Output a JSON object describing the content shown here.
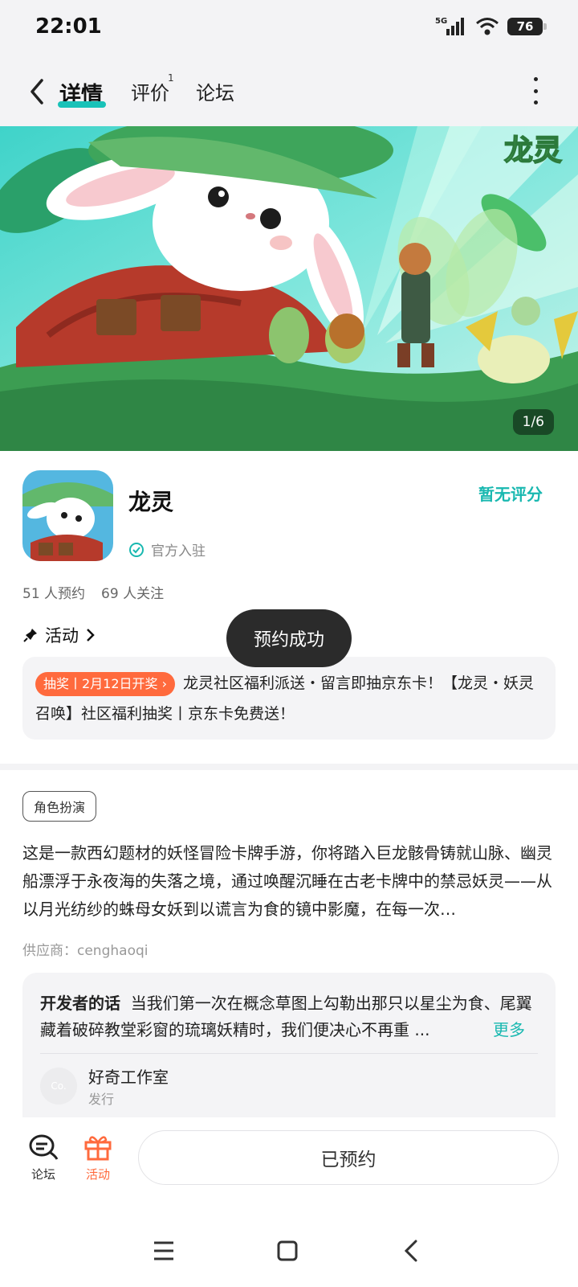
{
  "status_bar": {
    "time": "22:01",
    "network": "5G",
    "battery": "76"
  },
  "header": {
    "tabs": [
      {
        "label": "详情",
        "active": true
      },
      {
        "label": "评价",
        "badge": "1"
      },
      {
        "label": "论坛"
      }
    ]
  },
  "banner": {
    "counter": "1/6",
    "watermark": "龙灵"
  },
  "app": {
    "name": "龙灵",
    "official_label": "官方入驻",
    "rating": "暂无评分",
    "reservations": "51 人预约",
    "followers": "69 人关注"
  },
  "activity": {
    "heading": "活动",
    "badge": "抽奖丨2月12日开奖",
    "text": "龙灵社区福利派送・留言即抽京东卡！【龙灵・妖灵召唤】社区福利抽奖丨京东卡免费送！"
  },
  "toast": "预约成功",
  "description": {
    "tag": "角色扮演",
    "text": "这是一款西幻题材的妖怪冒险卡牌手游，你将踏入巨龙骸骨铸就山脉、幽灵船漂浮于永夜海的失落之境，通过唤醒沉睡在古老卡牌中的禁忌妖灵——从以月光纺纱的蛛母女妖到以谎言为食的镜中影魔，在每一次…",
    "supplier": "供应商：cenghaoqi"
  },
  "developer": {
    "label": "开发者的话",
    "words": "当我们第一次在概念草图上勾勒出那只以星尘为食、尾翼藏着破碎教堂彩窗的琉璃妖精时，我们便决心不再重 ...",
    "more": "更多",
    "avatar_text": "Co.",
    "studio": "好奇工作室",
    "role": "发行"
  },
  "bottom_bar": {
    "forum_label": "论坛",
    "activity_label": "活动",
    "reserve_button": "已预约"
  },
  "colors": {
    "accent": "#19c2b8",
    "activity": "#ff6a3d",
    "toast": "#2b2b2b"
  }
}
